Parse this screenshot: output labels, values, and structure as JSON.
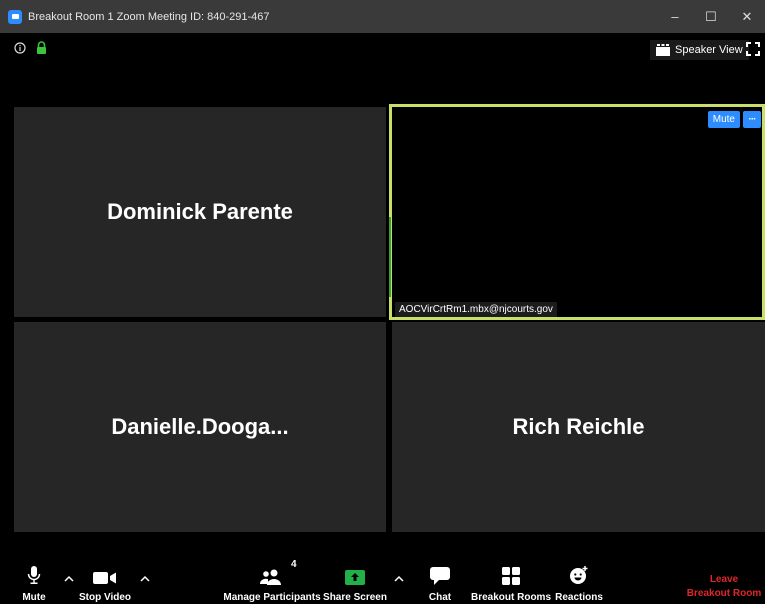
{
  "window": {
    "title": "Breakout Room 1   Zoom Meeting ID: 840-291-467",
    "minimize": "–",
    "maximize": "☐",
    "close": "✕"
  },
  "header": {
    "info_icon": "info-icon",
    "lock_icon": "lock-icon",
    "speaker_view_label": "Speaker View",
    "fullscreen_icon": "fullscreen-icon"
  },
  "participants": [
    {
      "name": "Dominick Parente",
      "video": false
    },
    {
      "name": "",
      "tag": "AOCVirCrtRm1.mbx@njcourts.gov",
      "video": true,
      "active_speaker": true,
      "mute_label": "Mute",
      "more_label": "···"
    },
    {
      "name": "Danielle.Dooga...",
      "video": false
    },
    {
      "name": "Rich Reichle",
      "video": false
    }
  ],
  "toolbar": {
    "mute_label": "Mute",
    "stop_video_label": "Stop Video",
    "participants_label": "Manage Participants",
    "participants_count": "4",
    "share_label": "Share Screen",
    "chat_label": "Chat",
    "breakout_label": "Breakout Rooms",
    "reactions_label": "Reactions",
    "leave_line1": "Leave",
    "leave_line2": "Breakout Room"
  },
  "colors": {
    "accent": "#2d8cff",
    "active_border": "#c8e06a",
    "share_green": "#22b04a",
    "leave_red": "#e0262a",
    "lock_green": "#3cc43c"
  }
}
